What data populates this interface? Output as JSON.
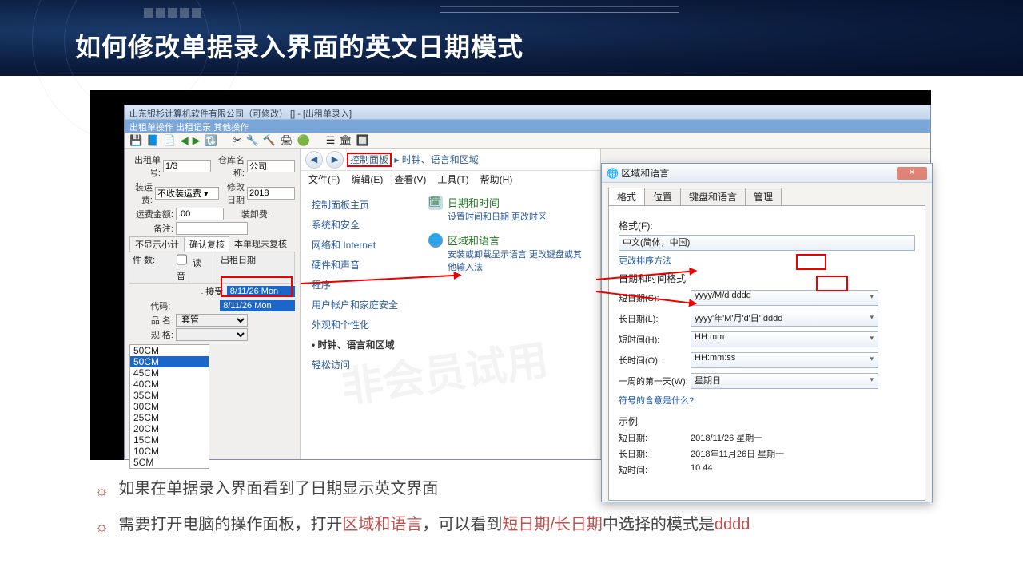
{
  "slide": {
    "title": "如何修改单据录入界面的英文日期模式",
    "bullet1": "如果在单据录入界面看到了日期显示英文界面",
    "bullet2_pre": "需要打开电脑的操作面板，打开",
    "bullet2_r1": "区域和语言",
    "bullet2_mid": "，可以看到",
    "bullet2_r2": "短日期/长日期",
    "bullet2_mid2": "中选择的模式是",
    "bullet2_r3": "dddd"
  },
  "app": {
    "mainTitle": "山东银杉计算机软件有限公司（可修改）   [] - [出租单录入]",
    "menu": "出租单操作  出租记录  其他操作",
    "left": {
      "l_billno": "出租单号:",
      "v_billno": "1/3",
      "l_wh": "仓库名称:",
      "v_wh": "公司",
      "l_ship": "装运费:",
      "v_ship": "不收装运费 ▾",
      "l_mdate": "修改日期",
      "v_mdate": "2018",
      "l_amt": "运费金额:",
      "v_amt": ".00",
      "l_load": "装卸费:",
      "l_note": "备注:",
      "tab_hide": "不显示小计",
      "tab_confirm": "确认复核",
      "v_confirm": "本单现未复核",
      "l_count": "件  数:",
      "ck_read": "读音",
      "col_date": "出租日期",
      "l_recv": "接受",
      "recv_date": "8/11/26 Mon",
      "l_code": "代码:",
      "code_date": "8/11/26 Mon",
      "l_name": "品  名:",
      "sel_name": "套管",
      "l_spec": "规  格:",
      "sizes": [
        "50CM",
        "50CM",
        "45CM",
        "40CM",
        "35CM",
        "30CM",
        "25CM",
        "20CM",
        "15CM",
        "10CM",
        "5CM"
      ]
    }
  },
  "cp": {
    "bcr_cp": "控制面板",
    "bcr_rl": "时钟、语言和区域",
    "menu": [
      "文件(F)",
      "编辑(E)",
      "查看(V)",
      "工具(T)",
      "帮助(H)"
    ],
    "side": [
      "控制面板主页",
      "系统和安全",
      "网络和 Internet",
      "硬件和声音",
      "程序",
      "用户帐户和家庭安全",
      "外观和个性化",
      "时钟、语言和区域",
      "轻松访问"
    ],
    "item1_t": "日期和时间",
    "item1_s": "设置时间和日期   更改时区",
    "item2_t": "区域和语言",
    "item2_s": "安装或卸载显示语言   更改键盘或其他输入法"
  },
  "dlg": {
    "title": "区域和语言",
    "tabs": [
      "格式",
      "位置",
      "键盘和语言",
      "管理"
    ],
    "l_format": "格式(F):",
    "v_format": "中文(简体，中国)",
    "link_sort": "更改排序方法",
    "sec_dt": "日期和时间格式",
    "l_sdate": "短日期(S):",
    "v_sdate": "yyyy/M/d dddd",
    "l_ldate": "长日期(L):",
    "v_ldate": "yyyy'年'M'月'd'日' dddd",
    "l_stime": "短时间(H):",
    "v_stime": "HH:mm",
    "l_ltime": "长时间(O):",
    "v_ltime": "HH:mm:ss",
    "l_firstday": "一周的第一天(W):",
    "v_firstday": "星期日",
    "link_sym": "符号的含意是什么?",
    "sec_ex": "示例",
    "ex_sd_l": "短日期:",
    "ex_sd_v": "2018/11/26 星期一",
    "ex_ld_l": "长日期:",
    "ex_ld_v": "2018年11月26日 星期一",
    "ex_st_l": "短时间:",
    "ex_st_v": "10:44"
  },
  "watermark": "非会员试用"
}
